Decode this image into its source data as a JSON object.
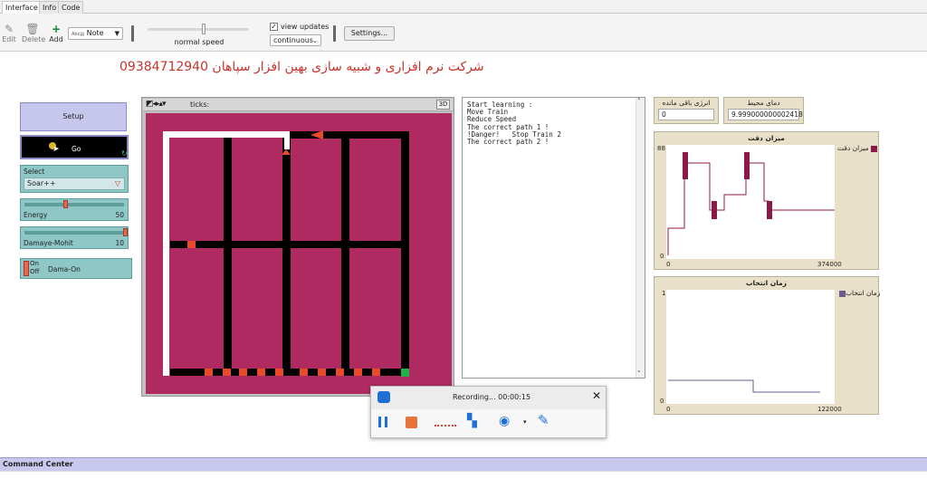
{
  "tabs": [
    "Interface",
    "Info",
    "Code"
  ],
  "toolbar": {
    "edit_label": "Edit",
    "delete_label": "Delete",
    "add_label": "Add",
    "widget_type": "Note",
    "speed_label": "normal speed",
    "view_updates_label": "view updates",
    "view_updates_checked": true,
    "update_mode": "continuous",
    "settings_label": "Settings..."
  },
  "header": {
    "title": "شرکت نرم افزاری و شبیه سازی بهین افزار سپاهان  09384712940"
  },
  "controls": {
    "setup_label": "Setup",
    "go_label": "Go",
    "chooser": {
      "label": "Select",
      "value": "Soar++"
    },
    "sliders": [
      {
        "label": "Energy",
        "value": "50",
        "fraction": 0.5
      },
      {
        "label": "Damaye-Mohit",
        "value": "10",
        "fraction": 1.0
      }
    ],
    "switch": {
      "on_label": "On",
      "off_label": "Off",
      "label": "Dama-On"
    }
  },
  "view": {
    "ticks_label": "ticks:",
    "three_d_label": "3D"
  },
  "output_lines": [
    "Start learning :",
    "Move Train",
    "Reduce Speed",
    "The correct path 1 !",
    "!Danger!   Stop Train 2",
    "The correct path 2 !"
  ],
  "monitors": [
    {
      "label": "انرژی باقی مانده",
      "value": "0"
    },
    {
      "label": "دمای محیط",
      "value": "9.999000000002418"
    }
  ],
  "plots": [
    {
      "title": "میزان دقت",
      "legend": "میزان دقت",
      "color": "#8b1a4a",
      "y_max": "88",
      "y_min": "0",
      "x_min": "0",
      "x_max": "374000"
    },
    {
      "title": "زمان انتخاب",
      "legend": "زمان انتخاب",
      "color": "#6c5a8c",
      "y_max": "1",
      "y_min": "0",
      "x_min": "0",
      "x_max": "122000"
    }
  ],
  "recorder": {
    "status": "Recording... 00:00:15"
  },
  "command_center": {
    "label": "Command Center"
  },
  "colors": {
    "title_red": "#c8342c",
    "world": "#b02a62",
    "track": "#000000",
    "path": "#ffffff",
    "marker": "#e84a2a",
    "goal": "#22b04a"
  }
}
